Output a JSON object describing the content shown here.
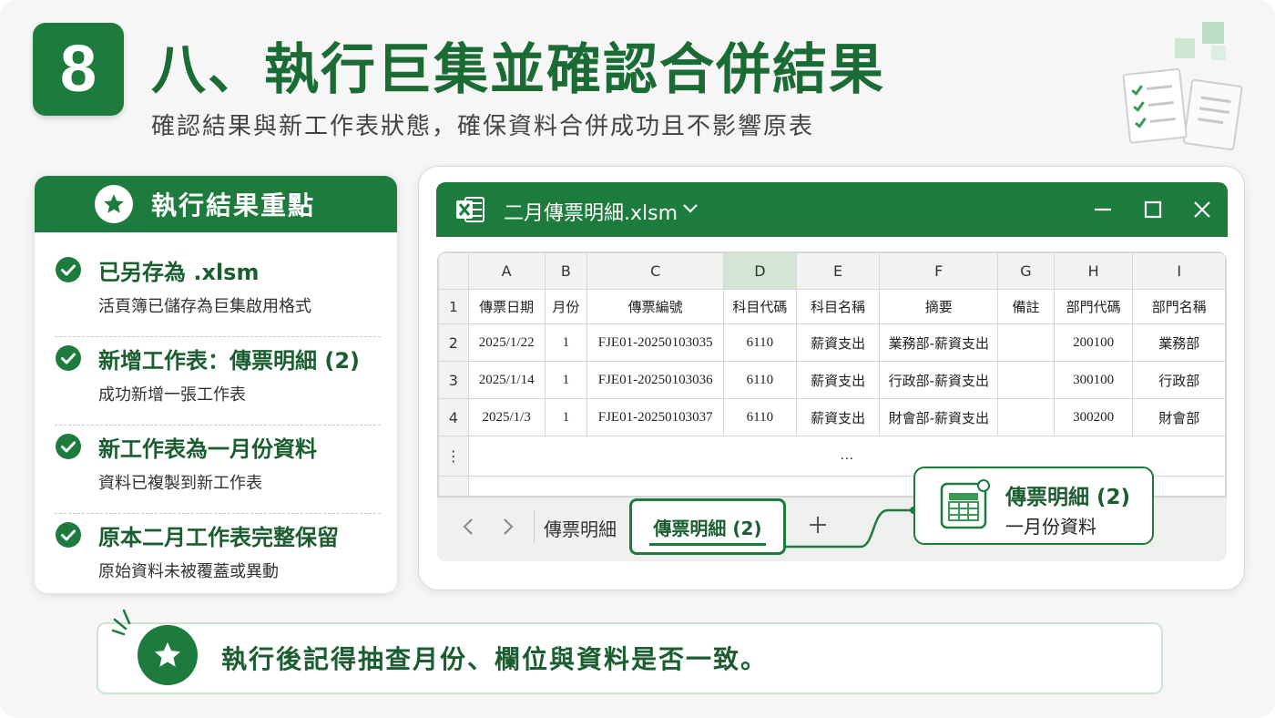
{
  "header": {
    "step_number": "8",
    "title": "八、執行巨集並確認合併結果",
    "subtitle": "確認結果與新工作表狀態，確保資料合併成功且不影響原表"
  },
  "key_points": {
    "title": "執行結果重點",
    "items": [
      {
        "title": "已另存為 .xlsm",
        "desc": "活頁簿已儲存為巨集啟用格式"
      },
      {
        "title": "新增工作表：傳票明細 (2)",
        "desc": "成功新增一張工作表"
      },
      {
        "title": "新工作表為一月份資料",
        "desc": "資料已複製到新工作表"
      },
      {
        "title": "原本二月工作表完整保留",
        "desc": "原始資料未被覆蓋或異動"
      }
    ]
  },
  "window": {
    "title": "二月傳票明細.xlsm",
    "controls": [
      "minimize",
      "maximize",
      "close"
    ]
  },
  "sheet": {
    "selected_column": "D",
    "columns": [
      "A",
      "B",
      "C",
      "D",
      "E",
      "F",
      "G",
      "H",
      "I"
    ],
    "headers": [
      "傳票日期",
      "月份",
      "傳票編號",
      "科目代碼",
      "科目名稱",
      "摘要",
      "備註",
      "部門代碼",
      "部門名稱"
    ],
    "rows": [
      {
        "num": "2",
        "cells": [
          "2025/1/22",
          "1",
          "FJE01-20250103035",
          "6110",
          "薪資支出",
          "業務部-薪資支出",
          "",
          "200100",
          "業務部"
        ]
      },
      {
        "num": "3",
        "cells": [
          "2025/1/14",
          "1",
          "FJE01-20250103036",
          "6110",
          "薪資支出",
          "行政部-薪資支出",
          "",
          "300100",
          "行政部"
        ]
      },
      {
        "num": "4",
        "cells": [
          "2025/1/3",
          "1",
          "FJE01-20250103037",
          "6110",
          "薪資支出",
          "財會部-薪資支出",
          "",
          "300200",
          "財會部"
        ]
      }
    ],
    "header_row_num": "1",
    "ellipsis_row": "⋮",
    "ellipsis_cell": "…"
  },
  "tabs": {
    "inactive": "傳票明細",
    "active": "傳票明細 (2)"
  },
  "callout": {
    "title": "傳票明細 (2)",
    "subtitle": "一月份資料"
  },
  "tip": {
    "text": "執行後記得抽查月份、欄位與資料是否一致。"
  },
  "colors": {
    "primary": "#1e7b3e",
    "primary_text": "#1a5e30",
    "selected_column": "#d3e6d6"
  }
}
